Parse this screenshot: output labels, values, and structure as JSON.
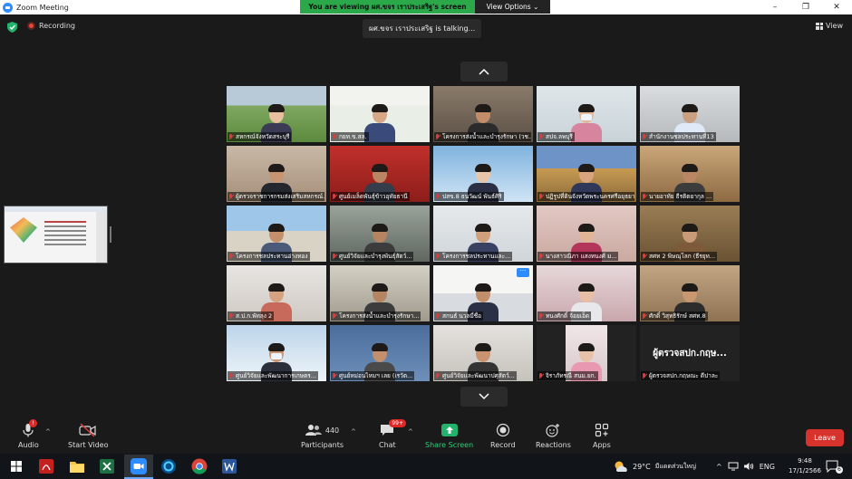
{
  "window": {
    "title": "Zoom Meeting",
    "controls": [
      "–",
      "❐",
      "✕"
    ]
  },
  "banner": {
    "viewing": "You are viewing ผศ.ขจร เราประเสริฐ's screen",
    "view_options": "View Options ⌄"
  },
  "status": {
    "recording": "Recording",
    "talking": "ผศ.ขจร เราประเสริฐ is  talking...",
    "view": "View"
  },
  "participants": [
    "สหกรณ์จังหวัดสระบุรี",
    "กยท.ข.สล.",
    "โครงการส่งน้ำและบำรุงรักษา (วช...",
    "สปจ.ลพบุรี",
    "สำนักงานชลประทานที่13",
    "ผู้ตรวจราชการกรมส่งเสริมสหกรณ์...",
    "ศูนย์เมล็ดพันธุ์ข้าวอุทัยธานี",
    "ปสข.8 ธนวัฒน์ พันธ์ศิริ",
    "ปฏิรูปที่ดินจังหวัดพระนครศรีอยุธยา",
    "นายอาทัย ธีรติตยากุล ...",
    "โครงการชลประทานอ่างทอง",
    "ศูนย์วิจัยและบำรุงพันธุ์สัตว์...",
    "โครงการชลประทานและ...",
    "นางสาวณิภา แสงทนงศ์ ม...",
    "สศท 2 พิษณุโลก (ธีรยุท...",
    "ส.ป.ก.พัทลุง 2",
    "โครงการส่งน้ำและบำรุงรักษา...",
    "สกนธ์ นวลมี่ชื่อ",
    "ทนงศักดิ์ จ้อยเอ็ด",
    "ศักดิ์ วิสุทธิรักษ์ สศท.8",
    "ศูนย์วิจัยและพัฒนาการเกษตร...",
    "ศูนย์หม่อนไหมฯ เลย (เรวัต...",
    "ศูนย์วิจัยและพัฒนาปศุสัตว์...",
    "จิราภัทรณี สนม.ยก.",
    "ผู้ตรวจสปก.กฤษณะ ดีปาละ"
  ],
  "last_tile_big": "ผู้ตรวจสปก.กฤษ...",
  "toolbar": {
    "audio": "Audio",
    "start_video": "Start Video",
    "participants_count": "440",
    "participants": "Participants",
    "chat_badge": "99+",
    "chat": "Chat",
    "share_screen": "Share Screen",
    "record": "Record",
    "reactions": "Reactions",
    "apps": "Apps",
    "leave": "Leave"
  },
  "taskbar": {
    "weather": "29°C",
    "weather_desc": "มีแดดส่วนใหญ่",
    "language": "ENG",
    "time": "9:48",
    "date": "17/1/2566",
    "notifications": "6"
  },
  "colors": {
    "accent": "#2d8cff",
    "banner_green": "#2ba84a",
    "leave_red": "#d8322c",
    "share_green": "#23b26b"
  }
}
